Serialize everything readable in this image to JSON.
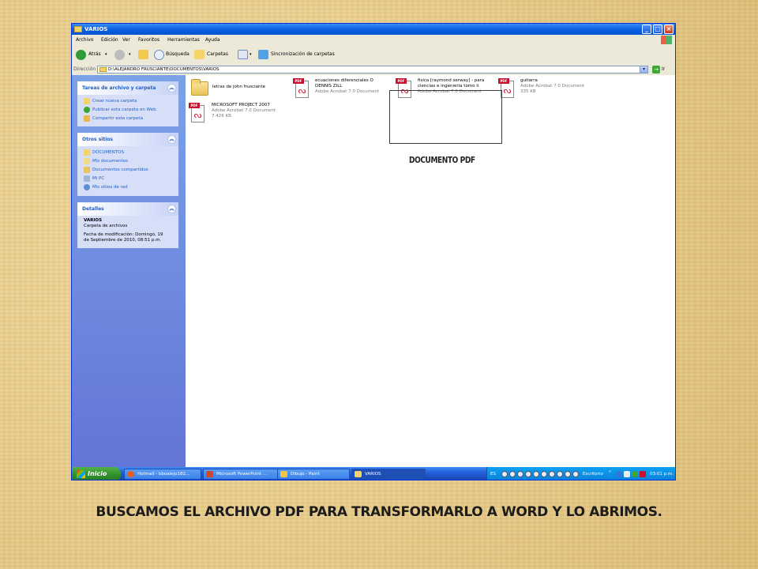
{
  "window": {
    "title": "VARIOS",
    "menu": [
      "Archivo",
      "Edición",
      "Ver",
      "Favoritos",
      "Herramientas",
      "Ayuda"
    ],
    "toolbar": {
      "back": "Atrás",
      "search": "Búsqueda",
      "folders": "Carpetas",
      "sync": "Sincronización de carpetas"
    },
    "address": {
      "label": "Dirección",
      "path": "D:\\ALEJANDRO FRUSCIANTE\\DOCUMENTOS\\VARIOS",
      "go": "Ir"
    }
  },
  "sidebar": {
    "tasks": {
      "title": "Tareas de archivo y carpeta",
      "items": [
        "Crear nueva carpeta",
        "Publicar esta carpeta en Web",
        "Compartir esta carpeta"
      ]
    },
    "places": {
      "title": "Otros sitios",
      "items": [
        "DOCUMENTOS",
        "Mis documentos",
        "Documentos compartidos",
        "Mi PC",
        "Mis sitios de red"
      ]
    },
    "details": {
      "title": "Detalles",
      "name": "VARIOS",
      "type": "Carpeta de archivos",
      "modified_1": "Fecha de modificación: Domingo, 19",
      "modified_2": "de Septiembre de 2010, 08:51 p.m."
    }
  },
  "files": [
    {
      "name": "letras de john frusciante",
      "kind": "folder"
    },
    {
      "name_1": "ecuaciones diferenciales O",
      "name_2": "DENNIS ZILL",
      "type": "Adobe Acrobat 7.0 Document",
      "kind": "pdf"
    },
    {
      "name_1": "fisica [raymond serway] - para",
      "name_2": "ciencias e ingenieria tomo ii",
      "type": "Adobe Acrobat 7.0 Document",
      "kind": "pdf"
    },
    {
      "name_1": "guitarra",
      "type": "Adobe Acrobat 7.0 Document",
      "size": "335 KB",
      "kind": "pdf"
    },
    {
      "name_1": "MICROSOFT PROJECT 2007",
      "type": "Adobe Acrobat 7.0 Document",
      "size": "7.426 KB",
      "kind": "pdf"
    }
  ],
  "icons": {
    "pdf_tag": "PDF",
    "pdf_sub": "Adobe"
  },
  "annotation": "DOCUMENTO PDF",
  "taskbar": {
    "start": "Inicio",
    "buttons": [
      "Hotmail - bboalejo182...",
      "Microsoft PowerPoint ...",
      "Dibujo - Paint",
      "VARIOS"
    ],
    "lang": "ES",
    "desk": "Escritorio",
    "time": "03:01 p.m."
  },
  "caption": "BUSCAMOS EL ARCHIVO PDF PARA TRANSFORMARLO A WORD Y LO ABRIMOS."
}
